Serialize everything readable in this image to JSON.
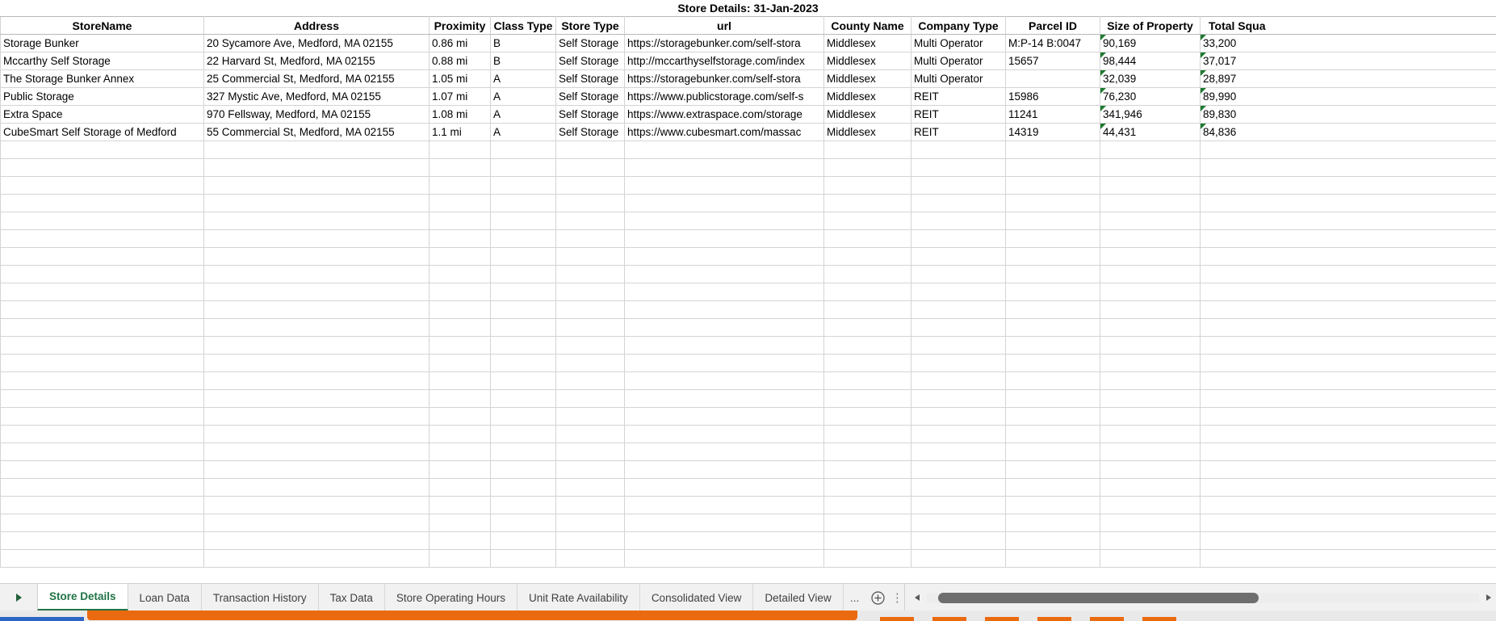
{
  "sheet": {
    "title": "Store Details: 31-Jan-2023",
    "columns": [
      "StoreName",
      "Address",
      "Proximity",
      "Class Type",
      "Store Type",
      "url",
      "County Name",
      "Company Type",
      "Parcel ID",
      "Size of Property",
      "Total Squa"
    ],
    "rows": [
      {
        "store_name": "Storage Bunker",
        "address": "20 Sycamore Ave, Medford, MA 02155",
        "proximity": "0.86 mi",
        "class_type": "B",
        "store_type": "Self Storage",
        "url": "https://storagebunker.com/self-stora",
        "county_name": "Middlesex",
        "company_type": "Multi Operator",
        "parcel_id": "M:P-14 B:0047",
        "size_of_property": "90,169",
        "total_square": "33,200"
      },
      {
        "store_name": "Mccarthy Self Storage",
        "address": "22 Harvard St, Medford, MA 02155",
        "proximity": "0.88 mi",
        "class_type": "B",
        "store_type": "Self Storage",
        "url": "http://mccarthyselfstorage.com/index",
        "county_name": "Middlesex",
        "company_type": "Multi Operator",
        "parcel_id": "15657",
        "size_of_property": "98,444",
        "total_square": "37,017"
      },
      {
        "store_name": "The Storage Bunker Annex",
        "address": "25 Commercial St, Medford, MA 02155",
        "proximity": "1.05 mi",
        "class_type": "A",
        "store_type": "Self Storage",
        "url": "https://storagebunker.com/self-stora",
        "county_name": "Middlesex",
        "company_type": "Multi Operator",
        "parcel_id": "",
        "size_of_property": "32,039",
        "total_square": "28,897"
      },
      {
        "store_name": "Public Storage",
        "address": "327 Mystic Ave, Medford, MA 02155",
        "proximity": "1.07 mi",
        "class_type": "A",
        "store_type": "Self Storage",
        "url": "https://www.publicstorage.com/self-s",
        "county_name": "Middlesex",
        "company_type": "REIT",
        "parcel_id": "15986",
        "size_of_property": "76,230",
        "total_square": "89,990"
      },
      {
        "store_name": "Extra Space",
        "address": "970 Fellsway, Medford, MA 02155",
        "proximity": "1.08 mi",
        "class_type": "A",
        "store_type": "Self Storage",
        "url": "https://www.extraspace.com/storage",
        "county_name": "Middlesex",
        "company_type": "REIT",
        "parcel_id": "11241",
        "size_of_property": "341,946",
        "total_square": "89,830"
      },
      {
        "store_name": "CubeSmart Self Storage of Medford",
        "address": "55 Commercial St, Medford, MA 02155",
        "proximity": "1.1 mi",
        "class_type": "A",
        "store_type": "Self Storage",
        "url": "https://www.cubesmart.com/massac",
        "county_name": "Middlesex",
        "company_type": "REIT",
        "parcel_id": "14319",
        "size_of_property": "44,431",
        "total_square": "84,836"
      }
    ],
    "empty_row_count": 24
  },
  "tabbar": {
    "nav_icon": "tab-scroll-right-icon",
    "tabs": [
      {
        "label": "Store Details",
        "active": true
      },
      {
        "label": "Loan Data",
        "active": false
      },
      {
        "label": "Transaction History",
        "active": false
      },
      {
        "label": "Tax Data",
        "active": false
      },
      {
        "label": "Store Operating Hours",
        "active": false
      },
      {
        "label": "Unit Rate Availability",
        "active": false
      },
      {
        "label": "Consolidated View",
        "active": false
      },
      {
        "label": "Detailed View",
        "active": false
      }
    ],
    "overflow_label": "...",
    "add_sheet_icon": "plus-circle-icon",
    "split_handle": "⋮",
    "scroll_left_icon": "triangle-left-icon",
    "scroll_right_icon": "triangle-right-icon"
  },
  "colors": {
    "accent_green": "#217346",
    "flag_green": "#1f7a31",
    "taskbar_orange": "#ea6a10",
    "grid_line": "#d4d4d4"
  }
}
